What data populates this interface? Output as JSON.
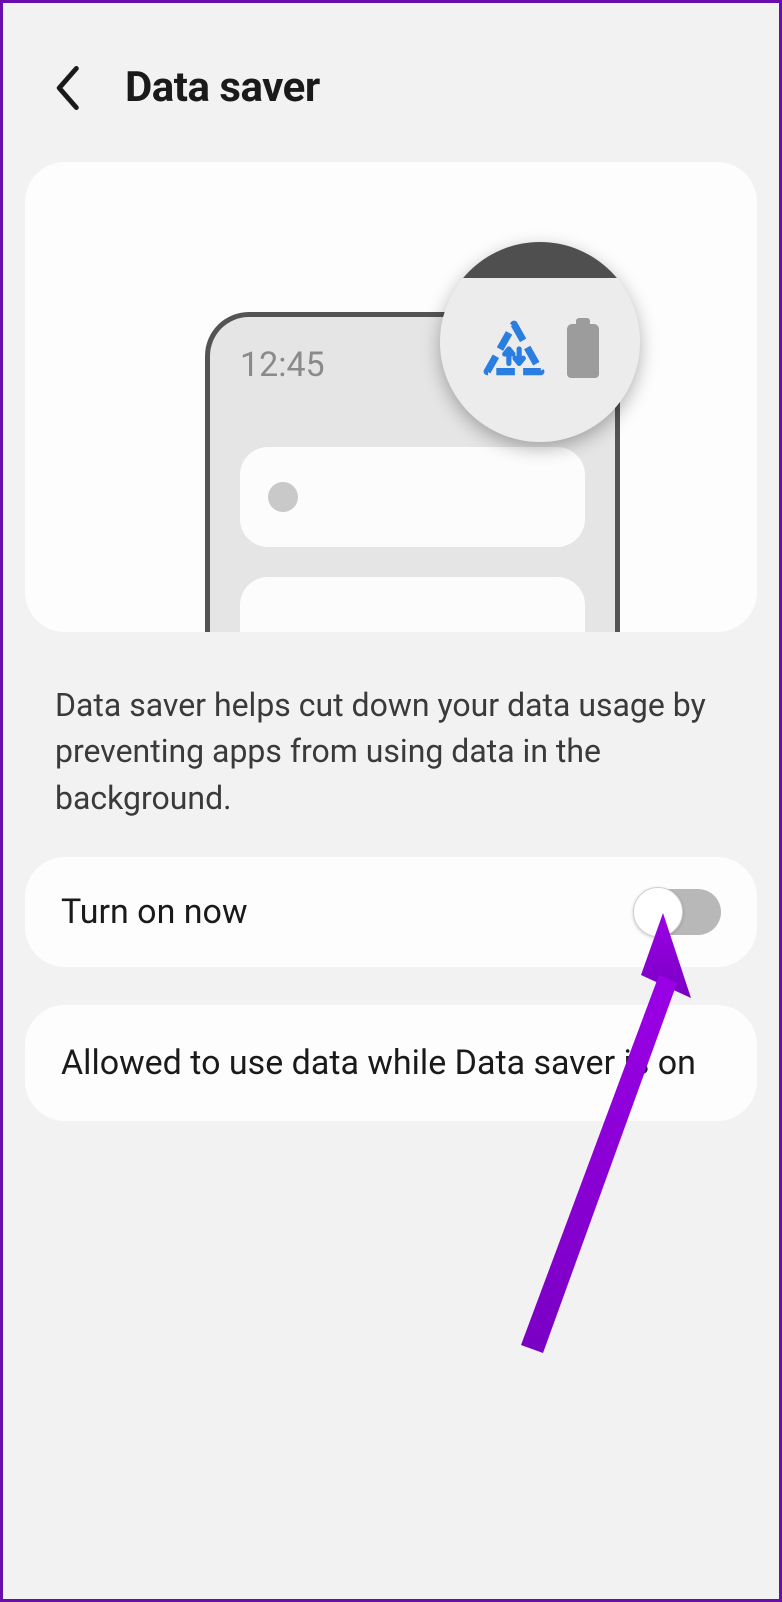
{
  "header": {
    "title": "Data saver"
  },
  "illustration": {
    "time": "12:45"
  },
  "description": "Data saver helps cut down your data usage by preventing apps from using data in the background.",
  "rows": {
    "toggle": {
      "label": "Turn on now",
      "state": "off"
    },
    "allowed": {
      "label": "Allowed to use data while Data saver is on"
    }
  },
  "colors": {
    "accent": "#2a7de1",
    "annotation": "#8a00d4"
  }
}
